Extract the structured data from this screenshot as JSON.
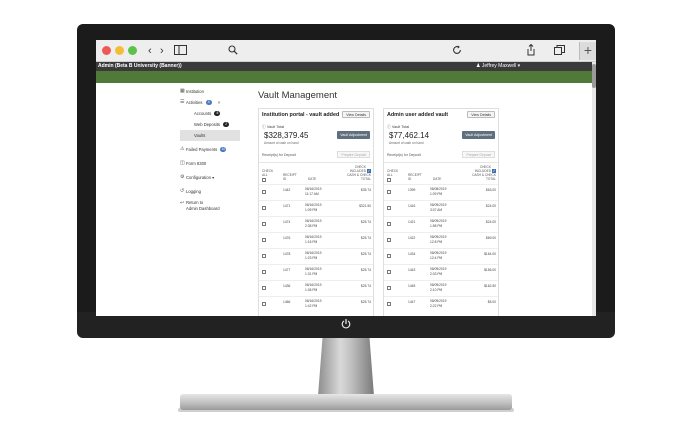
{
  "browser": {
    "plus_label": "+"
  },
  "app": {
    "title": "Admin (Beta B University (Banner))",
    "user": "Jeffrey Maxwell"
  },
  "sidebar": {
    "items": [
      {
        "label": "Institution",
        "icon": "building-icon"
      },
      {
        "label": "Activities",
        "icon": "list-icon",
        "badge": "4"
      },
      {
        "label": "Failed Payments",
        "icon": "warning-icon",
        "badge": "10"
      },
      {
        "label": "Form 8300",
        "icon": "document-icon"
      },
      {
        "label": "Configuration",
        "icon": "gear-icon"
      },
      {
        "label": "Logging",
        "icon": "history-icon"
      }
    ],
    "subitems": [
      {
        "label": "Accounts",
        "badge": "8"
      },
      {
        "label": "Web Deposits",
        "badge": "2"
      },
      {
        "label": "Vaults"
      }
    ],
    "return_line1": "Return to",
    "return_line2": "Admin Dashboard"
  },
  "page_title": "Vault Management",
  "panels": [
    {
      "title": "Institution portal - vault added",
      "view_details": "View Details",
      "vault_total_label": "Vault Total",
      "amount": "$328,379.45",
      "amount_sub": "Amount of cash on hand",
      "vault_adjustment": "Vault Adjustment",
      "selected_text": "Receipt(s) for Deposit",
      "prepare_deposit": "Prepare Deposit",
      "headers": {
        "check_all": "CHECK ALL",
        "receipt_id": "RECEIPT ID",
        "date": "DATE",
        "check_included": "CHECK INCLUDED",
        "total": "CASH & CHECK TOTAL"
      },
      "rows": [
        {
          "id": "1442",
          "date1": "08/16/2019",
          "date2": "11:17 AM",
          "total": "$35.74"
        },
        {
          "id": "1471",
          "date1": "08/16/2019",
          "date2": "1:09 PM",
          "total": "$321.50"
        },
        {
          "id": "1474",
          "date1": "08/16/2019",
          "date2": "2:38 PM",
          "total": "$25.74"
        },
        {
          "id": "1476",
          "date1": "08/16/2019",
          "date2": "1:16 PM",
          "total": "$25.74"
        },
        {
          "id": "1478",
          "date1": "08/16/2019",
          "date2": "1:23 PM",
          "total": "$25.74"
        },
        {
          "id": "1477",
          "date1": "08/16/2019",
          "date2": "1:31 PM",
          "total": "$25.74"
        },
        {
          "id": "1436",
          "date1": "08/16/2019",
          "date2": "1:36 PM",
          "total": "$25.74"
        },
        {
          "id": "1466",
          "date1": "08/16/2019",
          "date2": "1:42 PM",
          "total": "$25.74"
        }
      ]
    },
    {
      "title": "Admin user added vault",
      "view_details": "View Details",
      "vault_total_label": "Vault Total",
      "amount": "$77,462.14",
      "amount_sub": "Amount of cash on hand",
      "vault_adjustment": "Vault Adjustment",
      "selected_text": "Receipt(s) for Deposit",
      "prepare_deposit": "Prepare Deposit",
      "headers": {
        "check_all": "CHECK ALL",
        "receipt_id": "RECEIPT ID",
        "date": "DATE",
        "check_included": "CHECK INCLUDED",
        "total": "CASH & CHECK TOTAL"
      },
      "rows": [
        {
          "id": "1399",
          "date1": "08/08/2019",
          "date2": "1:09 PM",
          "total": "$63.00"
        },
        {
          "id": "1416",
          "date1": "08/09/2019",
          "date2": "3:07 AM",
          "total": "$24.00"
        },
        {
          "id": "1421",
          "date1": "08/09/2019",
          "date2": "1:58 PM",
          "total": "$24.00"
        },
        {
          "id": "1422",
          "date1": "08/09/2019",
          "date2": "12:8 PM",
          "total": "$69.00"
        },
        {
          "id": "1434",
          "date1": "08/09/2019",
          "date2": "12:4 PM",
          "total": "$164.00"
        },
        {
          "id": "1443",
          "date1": "08/09/2019",
          "date2": "2:03 PM",
          "total": "$156.00"
        },
        {
          "id": "1445",
          "date1": "08/09/2019",
          "date2": "2:10 PM",
          "total": "$162.50"
        },
        {
          "id": "1447",
          "date1": "08/09/2019",
          "date2": "2:22 PM",
          "total": "$5.00"
        }
      ]
    }
  ]
}
